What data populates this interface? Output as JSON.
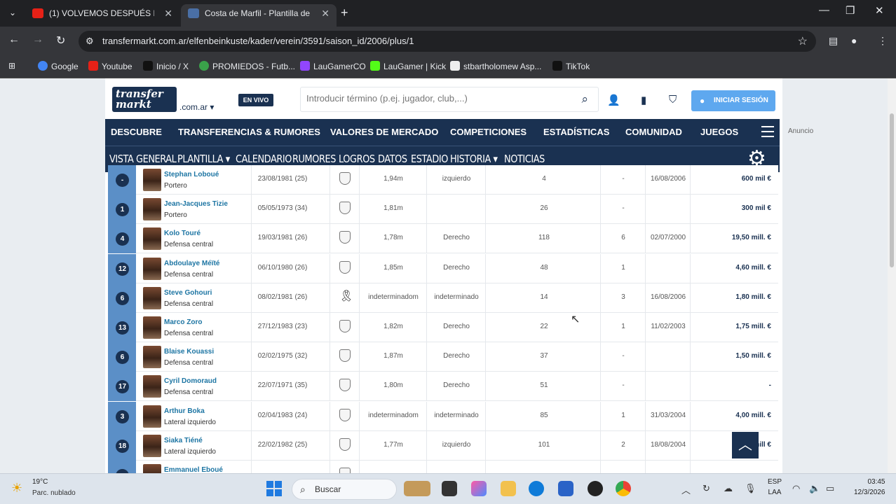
{
  "browser": {
    "tabs": [
      {
        "title": "(1) VOLVEMOS DESPUÉS D",
        "favicon_color": "#e62117"
      },
      {
        "title": "Costa de Marfil - Plantilla detall",
        "favicon_color": "#1a3151"
      }
    ],
    "url": "transfermarkt.com.ar/elfenbeinkuste/kader/verein/3591/saison_id/2006/plus/1",
    "bookmarks": [
      {
        "label": "Google",
        "color": "#4285f4"
      },
      {
        "label": "Youtube",
        "color": "#e62117"
      },
      {
        "label": "Inicio / X",
        "color": "#111111"
      },
      {
        "label": "PROMIEDOS - Futb...",
        "color": "#3aa14a"
      },
      {
        "label": "LauGamerCO",
        "color": "#9146ff"
      },
      {
        "label": "LauGamer | Kick",
        "color": "#53fc18"
      },
      {
        "label": "stbartholomew Asp...",
        "color": "#222222"
      },
      {
        "label": "TikTok",
        "color": "#111111"
      }
    ]
  },
  "site": {
    "logo_line1": "transfer",
    "logo_line2": "markt",
    "logo_domain": ".com.ar",
    "live_badge": "EN VIVO",
    "search_placeholder": "Introducir término (p.ej. jugador, club,...)",
    "login_label": "INICIAR SESIÓN",
    "main_nav": [
      "DESCUBRE",
      "TRANSFERENCIAS & RUMORES",
      "VALORES DE MERCADO",
      "COMPETICIONES",
      "ESTADÍSTICAS",
      "COMUNIDAD",
      "JUEGOS"
    ],
    "ad_label": "Anuncio",
    "sub_nav": [
      "VISTA GENERAL",
      "PLANTILLA",
      "CALENDARIO",
      "RUMORES",
      "LOGROS",
      "DATOS",
      "ESTADIO",
      "HISTORIA",
      "NOTICIAS"
    ],
    "accent_color": "#1a3151"
  },
  "players": [
    {
      "number": "-",
      "name": "Stephan Loboué",
      "position": "Portero",
      "birth": "23/08/1981 (25)",
      "height": "1,94m",
      "foot": "izquierdo",
      "caps": "4",
      "goals": "-",
      "debut": "16/08/2006",
      "value": "600 mil €",
      "crest": "club"
    },
    {
      "number": "1",
      "name": "Jean-Jacques Tizie",
      "position": "Portero",
      "birth": "05/05/1973 (34)",
      "height": "1,81m",
      "foot": "",
      "caps": "26",
      "goals": "-",
      "debut": "",
      "value": "300 mil €",
      "crest": "club"
    },
    {
      "number": "4",
      "name": "Kolo Touré",
      "position": "Defensa central",
      "birth": "19/03/1981 (26)",
      "height": "1,78m",
      "foot": "Derecho",
      "caps": "118",
      "goals": "6",
      "debut": "02/07/2000",
      "value": "19,50 mill. €",
      "crest": "club"
    },
    {
      "number": "12",
      "name": "Abdoulaye Méïté",
      "position": "Defensa central",
      "birth": "06/10/1980 (26)",
      "height": "1,85m",
      "foot": "Derecho",
      "caps": "48",
      "goals": "1",
      "debut": "",
      "value": "4,60 mill. €",
      "crest": "club"
    },
    {
      "number": "6",
      "name": "Steve Gohouri",
      "position": "Defensa central",
      "birth": "08/02/1981 (26)",
      "height": "indeterminadom",
      "foot": "indeterminado",
      "caps": "14",
      "goals": "3",
      "debut": "16/08/2006",
      "value": "1,80 mill. €",
      "crest": "ribbon"
    },
    {
      "number": "13",
      "name": "Marco Zoro",
      "position": "Defensa central",
      "birth": "27/12/1983 (23)",
      "height": "1,82m",
      "foot": "Derecho",
      "caps": "22",
      "goals": "1",
      "debut": "11/02/2003",
      "value": "1,75 mill. €",
      "crest": "club"
    },
    {
      "number": "6",
      "name": "Blaise Kouassi",
      "position": "Defensa central",
      "birth": "02/02/1975 (32)",
      "height": "1,87m",
      "foot": "Derecho",
      "caps": "37",
      "goals": "-",
      "debut": "",
      "value": "1,50 mill. €",
      "crest": "club"
    },
    {
      "number": "17",
      "name": "Cyril Domoraud",
      "position": "Defensa central",
      "birth": "22/07/1971 (35)",
      "height": "1,80m",
      "foot": "Derecho",
      "caps": "51",
      "goals": "-",
      "debut": "",
      "value": "-",
      "crest": "club"
    },
    {
      "number": "3",
      "name": "Arthur Boka",
      "position": "Lateral izquierdo",
      "birth": "02/04/1983 (24)",
      "height": "indeterminadom",
      "foot": "indeterminado",
      "caps": "85",
      "goals": "1",
      "debut": "31/03/2004",
      "value": "4,00 mill. €",
      "crest": "club"
    },
    {
      "number": "18",
      "name": "Siaka Tiéné",
      "position": "Lateral izquierdo",
      "birth": "22/02/1982 (25)",
      "height": "1,77m",
      "foot": "izquierdo",
      "caps": "101",
      "goals": "2",
      "debut": "18/08/2004",
      "value": "mill €",
      "crest": "club"
    },
    {
      "number": "-",
      "name": "Emmanuel Eboué",
      "position": "",
      "birth": "",
      "height": "",
      "foot": "",
      "caps": "",
      "goals": "",
      "debut": "",
      "value": "",
      "crest": "club"
    }
  ],
  "taskbar": {
    "temperature": "19°C",
    "weather": "Parc. nublado",
    "search": "Buscar",
    "lang1": "ESP",
    "lang2": "LAA",
    "time": "03:45",
    "date": "12/3/2026"
  }
}
